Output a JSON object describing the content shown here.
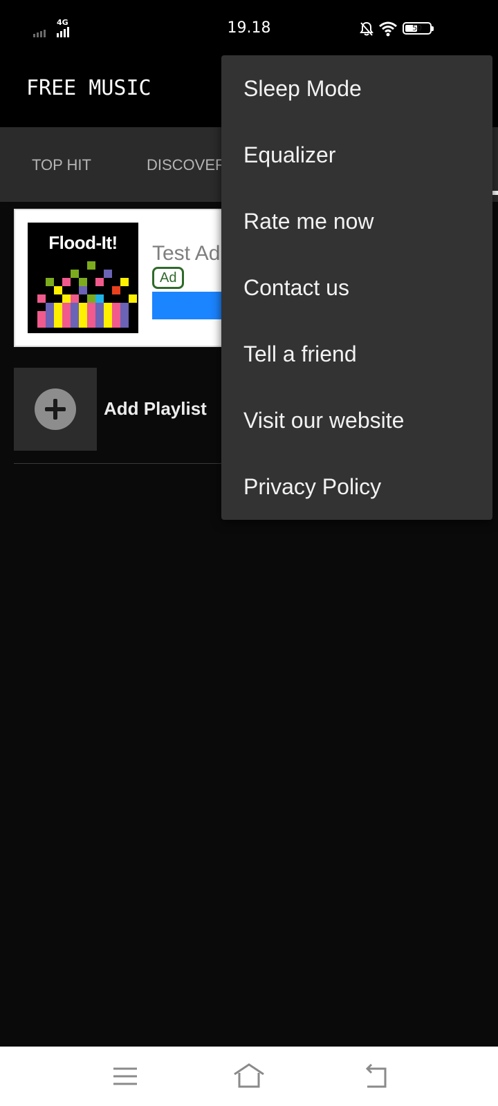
{
  "status_bar": {
    "time": "19.18",
    "network_label": "4G",
    "battery_level": "50",
    "icons": [
      "signal-icon",
      "mobile-signal-icon",
      "notifications-off-icon",
      "wifi-icon",
      "battery-icon"
    ]
  },
  "app": {
    "title": "FREE MUSIC"
  },
  "tabs": [
    {
      "label": "TOP HIT"
    },
    {
      "label": "DISCOVER"
    }
  ],
  "ad": {
    "image_title": "Flood-It!",
    "headline": "Test Ad",
    "badge": "Ad",
    "cta_color": "#1b84ff"
  },
  "playlist": {
    "add_label": "Add Playlist"
  },
  "menu": {
    "items": [
      {
        "label": "Sleep Mode"
      },
      {
        "label": "Equalizer"
      },
      {
        "label": "Rate me now"
      },
      {
        "label": "Contact us"
      },
      {
        "label": "Tell a friend"
      },
      {
        "label": "Visit our website"
      },
      {
        "label": "Privacy Policy"
      }
    ]
  },
  "nav_bar": {
    "icons": [
      "menu-icon",
      "home-icon",
      "back-icon"
    ]
  },
  "colors": {
    "background": "#0a0a0a",
    "menu_background": "#333333",
    "tab_bar": "#2b2b2b",
    "ad_badge": "#2f6a2a"
  }
}
